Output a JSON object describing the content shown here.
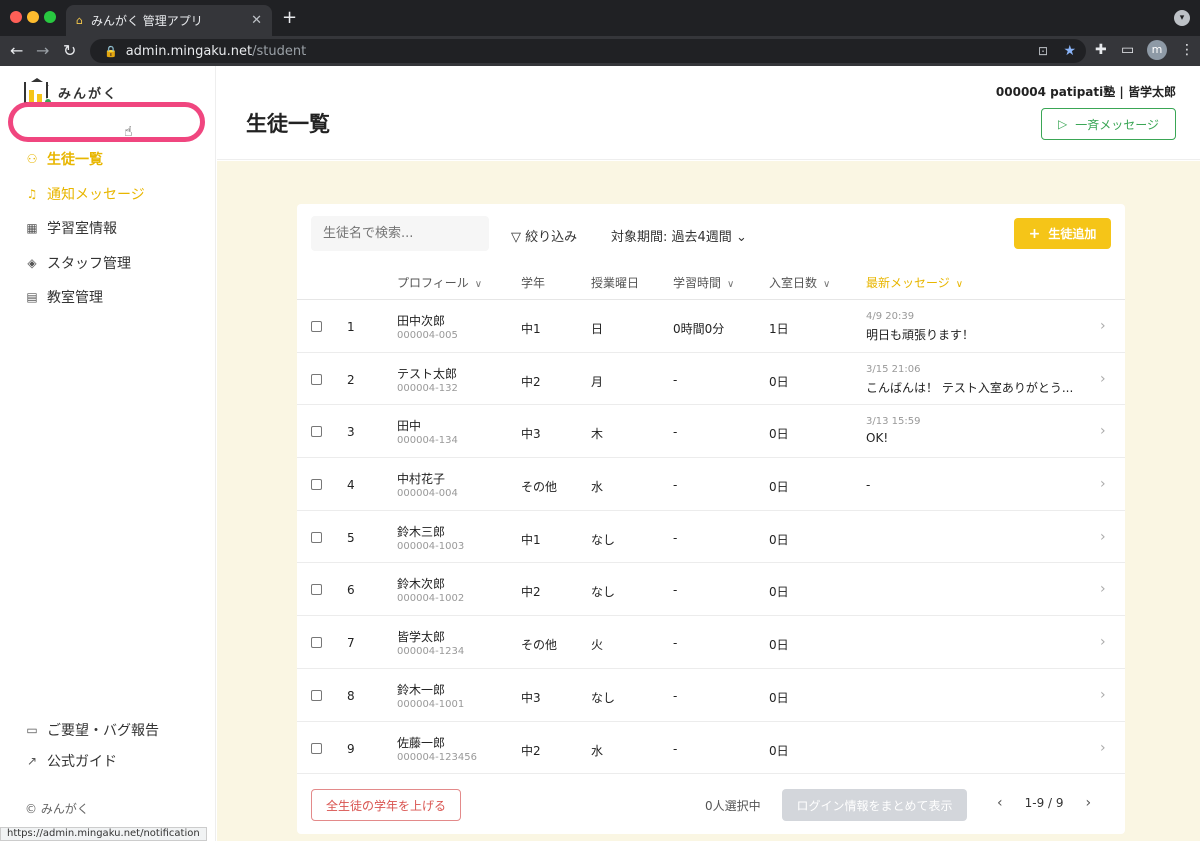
{
  "browser": {
    "tab_title": "みんがく 管理アプリ",
    "url_domain": "admin.mingaku.net",
    "url_path": "/student",
    "profile_initial": "m",
    "status_url": "https://admin.mingaku.net/notification"
  },
  "sidebar": {
    "logo_text": "みんがく",
    "items": [
      {
        "label": "生徒一覧",
        "icon": "people-icon"
      },
      {
        "label": "通知メッセージ",
        "icon": "bell-icon"
      },
      {
        "label": "学習室情報",
        "icon": "calendar-icon"
      },
      {
        "label": "スタッフ管理",
        "icon": "graduation-cap-icon"
      },
      {
        "label": "教室管理",
        "icon": "building-icon"
      }
    ],
    "bottom_items": [
      {
        "label": "ご要望・バグ報告",
        "icon": "comment-icon"
      },
      {
        "label": "公式ガイド",
        "icon": "external-link-icon"
      }
    ],
    "copyright": "© みんがく"
  },
  "header": {
    "title": "生徒一覧",
    "user_info": "000004 patipati塾 | 皆学太郎",
    "broadcast_label": "一斉メッセージ"
  },
  "toolbar": {
    "search_placeholder": "生徒名で検索...",
    "filter_label": "絞り込み",
    "period_label": "対象期間: 過去4週間",
    "add_label": "生徒追加"
  },
  "table": {
    "headers": {
      "profile": "プロフィール",
      "grade": "学年",
      "class_day": "授業曜日",
      "study_time": "学習時間",
      "entry_days": "入室日数",
      "latest_message": "最新メッセージ"
    },
    "rows": [
      {
        "no": "1",
        "name": "田中次郎",
        "id": "000004-005",
        "grade": "中1",
        "day": "日",
        "time": "0時間0分",
        "days": "1日",
        "msg_time": "4/9 20:39",
        "msg": "明日も頑張ります！"
      },
      {
        "no": "2",
        "name": "テスト太郎",
        "id": "000004-132",
        "grade": "中2",
        "day": "月",
        "time": "-",
        "days": "0日",
        "msg_time": "3/15 21:06",
        "msg": "こんばんは！ テスト入室ありがとう..."
      },
      {
        "no": "3",
        "name": "田中",
        "id": "000004-134",
        "grade": "中3",
        "day": "木",
        "time": "-",
        "days": "0日",
        "msg_time": "3/13 15:59",
        "msg": "OK!"
      },
      {
        "no": "4",
        "name": "中村花子",
        "id": "000004-004",
        "grade": "その他",
        "day": "水",
        "time": "-",
        "days": "0日",
        "msg_time": "",
        "msg": "-"
      },
      {
        "no": "5",
        "name": "鈴木三郎",
        "id": "000004-1003",
        "grade": "中1",
        "day": "なし",
        "time": "-",
        "days": "0日",
        "msg_time": "",
        "msg": ""
      },
      {
        "no": "6",
        "name": "鈴木次郎",
        "id": "000004-1002",
        "grade": "中2",
        "day": "なし",
        "time": "-",
        "days": "0日",
        "msg_time": "",
        "msg": ""
      },
      {
        "no": "7",
        "name": "皆学太郎",
        "id": "000004-1234",
        "grade": "その他",
        "day": "火",
        "time": "-",
        "days": "0日",
        "msg_time": "",
        "msg": ""
      },
      {
        "no": "8",
        "name": "鈴木一郎",
        "id": "000004-1001",
        "grade": "中3",
        "day": "なし",
        "time": "-",
        "days": "0日",
        "msg_time": "",
        "msg": ""
      },
      {
        "no": "9",
        "name": "佐藤一郎",
        "id": "000004-123456",
        "grade": "中2",
        "day": "水",
        "time": "-",
        "days": "0日",
        "msg_time": "",
        "msg": ""
      }
    ]
  },
  "footer": {
    "raise_grade_label": "全生徒の学年を上げる",
    "selected_count": "0人選択中",
    "login_info_label": "ログイン情報をまとめて表示",
    "pagination": "1-9 / 9"
  },
  "colors": {
    "accent_yellow": "#f5c518",
    "accent_green": "#3aa655",
    "highlight_pink": "#f0467f",
    "content_bg": "#faf6e3"
  }
}
